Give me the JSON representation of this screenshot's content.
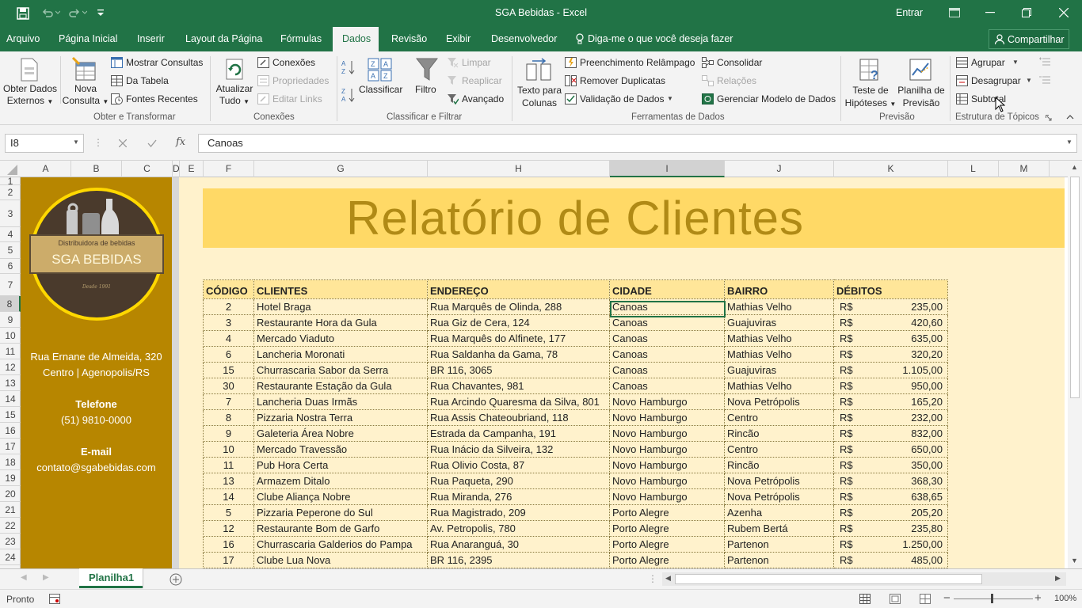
{
  "titlebar": {
    "title": "SGA Bebidas  -  Excel",
    "signin": "Entrar"
  },
  "menu": {
    "tabs": [
      "Arquivo",
      "Página Inicial",
      "Inserir",
      "Layout da Página",
      "Fórmulas",
      "Dados",
      "Revisão",
      "Exibir",
      "Desenvolvedor"
    ],
    "active": "Dados",
    "tellme": "Diga-me o que você deseja fazer",
    "share": "Compartilhar"
  },
  "ribbon": {
    "obter_dados": [
      "Obter Dados",
      "Externos"
    ],
    "nova_consulta": [
      "Nova",
      "Consulta"
    ],
    "mostrar_consultas": "Mostrar Consultas",
    "da_tabela": "Da Tabela",
    "fontes_recentes": "Fontes Recentes",
    "grp_obter": "Obter e Transformar",
    "atualizar": [
      "Atualizar",
      "Tudo"
    ],
    "conexoes": "Conexões",
    "propriedades": "Propriedades",
    "editar_links": "Editar Links",
    "grp_conexoes": "Conexões",
    "classificar": "Classificar",
    "filtro": "Filtro",
    "limpar": "Limpar",
    "reaplicar": "Reaplicar",
    "avancado": "Avançado",
    "grp_classificar": "Classificar e Filtrar",
    "texto_colunas": [
      "Texto para",
      "Colunas"
    ],
    "preenchimento": "Preenchimento Relâmpago",
    "remover_dup": "Remover Duplicatas",
    "validacao": "Validação de Dados",
    "consolidar": "Consolidar",
    "relacoes": "Relações",
    "gerenciar_modelo": "Gerenciar Modelo de Dados",
    "grp_ferramentas": "Ferramentas de Dados",
    "teste_hipoteses": [
      "Teste de",
      "Hipóteses"
    ],
    "planilha_previsao": [
      "Planilha de",
      "Previsão"
    ],
    "grp_previsao": "Previsão",
    "agrupar": "Agrupar",
    "desagrupar": "Desagrupar",
    "subtotal": "Subtotal",
    "grp_estrutura": "Estrutura de Tópicos"
  },
  "formula_bar": {
    "name_box": "I8",
    "fx": "fx",
    "value": "Canoas"
  },
  "columns": [
    "A",
    "B",
    "C",
    "D",
    "E",
    "F",
    "G",
    "H",
    "I",
    "J",
    "K",
    "L",
    "M"
  ],
  "rows": [
    "1",
    "2",
    "3",
    "4",
    "5",
    "6",
    "7",
    "8",
    "9",
    "10",
    "11",
    "12",
    "13",
    "14",
    "15",
    "16",
    "17",
    "18",
    "19",
    "20",
    "21",
    "22",
    "23",
    "24"
  ],
  "company": {
    "logo_line1": "Distribuidora de bebidas",
    "logo_name": "SGA BEBIDAS",
    "logo_since": "Desde 1991",
    "address1": "Rua Ernane de Almeida, 320",
    "address2": "Centro | Agenopolis/RS",
    "phone_label": "Telefone",
    "phone": "(51) 9810-0000",
    "email_label": "E-mail",
    "email": "contato@sgabebidas.com"
  },
  "report": {
    "title": "Relatório de Clientes"
  },
  "table": {
    "headers": [
      "CÓDIGO",
      "CLIENTES",
      "ENDEREÇO",
      "CIDADE",
      "BAIRRO",
      "DÉBITOS"
    ],
    "currency": "R$",
    "rows": [
      [
        "2",
        "Hotel Braga",
        "Rua Marquês de Olinda, 288",
        "Canoas",
        "Mathias Velho",
        "235,00"
      ],
      [
        "3",
        "Restaurante Hora da Gula",
        "Rua Giz de Cera, 124",
        "Canoas",
        "Guajuviras",
        "420,60"
      ],
      [
        "4",
        "Mercado Viaduto",
        "Rua Marquês do Alfinete, 177",
        "Canoas",
        "Mathias Velho",
        "635,00"
      ],
      [
        "6",
        "Lancheria Moronati",
        "Rua Saldanha da Gama, 78",
        "Canoas",
        "Mathias Velho",
        "320,20"
      ],
      [
        "15",
        "Churrascaria Sabor da Serra",
        "BR 116, 3065",
        "Canoas",
        "Guajuviras",
        "1.105,00"
      ],
      [
        "30",
        "Restaurante Estação da Gula",
        "Rua Chavantes, 981",
        "Canoas",
        "Mathias Velho",
        "950,00"
      ],
      [
        "7",
        "Lancheria Duas Irmãs",
        "Rua Arcindo Quaresma da Silva, 801",
        "Novo Hamburgo",
        "Nova Petrópolis",
        "165,20"
      ],
      [
        "8",
        "Pizzaria Nostra Terra",
        "Rua Assis Chateoubriand, 118",
        "Novo Hamburgo",
        "Centro",
        "232,00"
      ],
      [
        "9",
        "Galeteria Área Nobre",
        "Estrada da Campanha, 191",
        "Novo Hamburgo",
        "Rincão",
        "832,00"
      ],
      [
        "10",
        "Mercado Travessão",
        "Rua Inácio da Silveira, 132",
        "Novo Hamburgo",
        "Centro",
        "650,00"
      ],
      [
        "11",
        "Pub Hora Certa",
        "Rua Olivio Costa, 87",
        "Novo Hamburgo",
        "Rincão",
        "350,00"
      ],
      [
        "13",
        "Armazem Ditalo",
        "Rua Paqueta, 290",
        "Novo Hamburgo",
        "Nova Petrópolis",
        "368,30"
      ],
      [
        "14",
        "Clube Aliança Nobre",
        "Rua Miranda, 276",
        "Novo Hamburgo",
        "Nova Petrópolis",
        "638,65"
      ],
      [
        "5",
        "Pizzaria Peperone do Sul",
        "Rua Magistrado, 209",
        "Porto Alegre",
        "Azenha",
        "205,20"
      ],
      [
        "12",
        "Restaurante Bom de Garfo",
        "Av. Petropolis, 780",
        "Porto Alegre",
        "Rubem Bertá",
        "235,80"
      ],
      [
        "16",
        "Churrascaria Galderios do Pampa",
        "Rua Anaranguá, 30",
        "Porto Alegre",
        "Partenon",
        "1.250,00"
      ],
      [
        "17",
        "Clube Lua Nova",
        "BR 116, 2395",
        "Porto Alegre",
        "Partenon",
        "485,00"
      ]
    ]
  },
  "sheet_tab": "Planilha1",
  "status": {
    "ready": "Pronto",
    "zoom": "100%"
  },
  "colors": {
    "excel_green": "#217346",
    "panel": "#b78600",
    "banner": "#ffd966",
    "report_bg": "#fff2cc",
    "header_fill": "#ffe699"
  }
}
